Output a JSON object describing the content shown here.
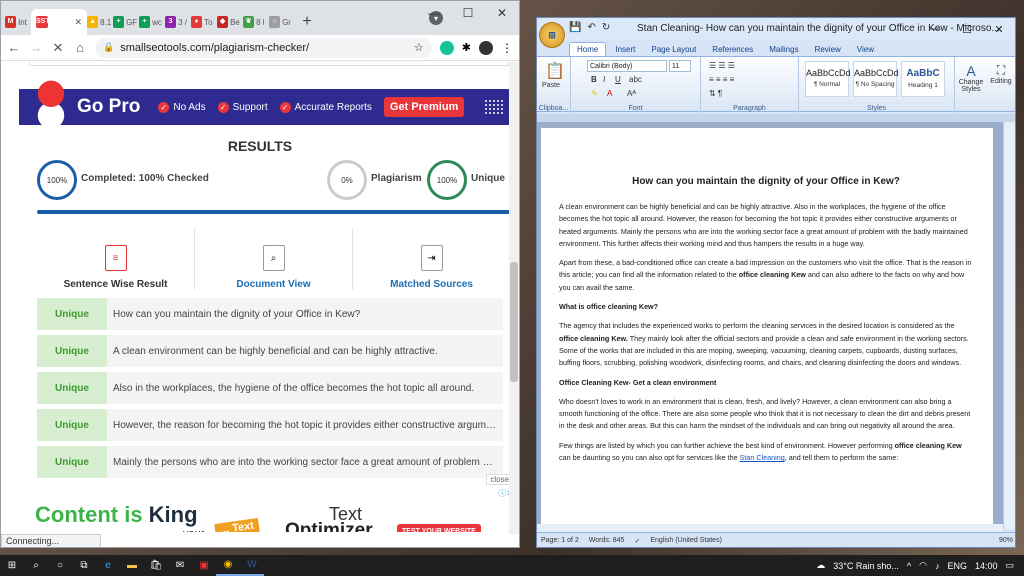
{
  "chrome": {
    "tabs": [
      {
        "label": "Int",
        "icon": "gmail-icon",
        "color": "#d93025",
        "glyph": "M"
      },
      {
        "label": "",
        "icon": "sst-icon",
        "color": "#e8363b",
        "glyph": "SST",
        "active": true
      },
      {
        "label": "8.1",
        "icon": "drive-icon",
        "color": "#f4b400",
        "glyph": "▲"
      },
      {
        "label": "GF",
        "icon": "sheets-icon",
        "color": "#0f9d58",
        "glyph": "+"
      },
      {
        "label": "wc",
        "icon": "sheets-icon",
        "color": "#0f9d58",
        "glyph": "+"
      },
      {
        "label": "3 /",
        "icon": "tab-icon",
        "color": "#8e24aa",
        "glyph": "3"
      },
      {
        "label": "To",
        "icon": "tab-icon",
        "color": "#e53935",
        "glyph": "♦"
      },
      {
        "label": "Be",
        "icon": "tab-icon",
        "color": "#c62828",
        "glyph": "◆"
      },
      {
        "label": "8 l",
        "icon": "leaf-icon",
        "color": "#43a047",
        "glyph": "❦"
      },
      {
        "label": "Gr",
        "icon": "tab-icon",
        "color": "#9e9e9e",
        "glyph": "○"
      }
    ],
    "new_tab": "+",
    "url": "smallseotools.com/plagiarism-checker/",
    "status": "Connecting..."
  },
  "promo": {
    "title": "Go Pro",
    "features": [
      "No Ads",
      "Support",
      "Accurate Reports"
    ],
    "cta": "Get Premium"
  },
  "results": {
    "heading": "RESULTS",
    "completed_pct": "100%",
    "completed_label": "Completed: 100% Checked",
    "plag_pct": "0%",
    "plag_label": "Plagiarism",
    "unique_pct": "100%",
    "unique_label": "Unique",
    "views": [
      "Sentence Wise Result",
      "Document View",
      "Matched Sources"
    ],
    "rows": [
      {
        "badge": "Unique",
        "text": "How can you maintain the dignity of your Office in Kew?"
      },
      {
        "badge": "Unique",
        "text": "A clean environment can be highly beneficial and can be highly attractive."
      },
      {
        "badge": "Unique",
        "text": "Also in the workplaces, the hygiene of the office becomes the hot topic all around."
      },
      {
        "badge": "Unique",
        "text": "However, the reason for becoming the hot topic it provides either constructive argument..."
      },
      {
        "badge": "Unique",
        "text": "Mainly the persons who are into the working sector face a great amount of problem wit..."
      }
    ]
  },
  "ad": {
    "close": "close",
    "line1a": "Content is ",
    "line1b": "King",
    "your": "your",
    "text_badge": "... Text",
    "t1": "Text",
    "t2": "Optimizer",
    "cta": "TEST YOUR WEBSITE"
  },
  "word": {
    "title": "Stan Cleaning- How can you maintain the dignity of your Office in Kew - Microso...",
    "tabs": [
      "Home",
      "Insert",
      "Page Layout",
      "References",
      "Mailings",
      "Review",
      "View"
    ],
    "font": "Calibri (Body)",
    "size": "11",
    "groups": [
      "Clipboa...",
      "Font",
      "Paragraph",
      "Styles"
    ],
    "paste": "Paste",
    "styles": [
      {
        "sample": "AaBbCcDd",
        "name": "¶ Normal"
      },
      {
        "sample": "AaBbCcDd",
        "name": "¶ No Spacing"
      },
      {
        "sample": "AaBbC",
        "name": "Heading 1"
      }
    ],
    "change_styles": "Change Styles",
    "editing": "Editing",
    "doc": {
      "heading": "How can you maintain the dignity of your Office in Kew?",
      "p1": "A clean environment can be highly beneficial and can be highly attractive. Also in the workplaces, the hygiene of the office becomes the hot topic all around. However, the reason for becoming the hot topic it provides either constructive arguments or heated arguments. Mainly the persons who are into the working sector face a great amount of problem with the badly maintained environment. This further affects their working mind and thus hampers the results in a huge way.",
      "p2a": "Apart from these, a bad-conditioned office can create a bad impression on the customers who visit the office. That is the reason in this article; you can find all the information related to the ",
      "p2b": "office cleaning Kew",
      "p2c": " and can also adhere to the facts on why and how you can avail the same.",
      "h2": "What is office cleaning Kew?",
      "p3a": "The agency that includes the experienced works to perform the cleaning services in the desired location is considered as the ",
      "p3b": "office cleaning Kew.",
      "p3c": " They mainly look after the official sectors and provide a clean and safe environment in the working sectors. Some of the works that are included in this are moping, sweeping, vacuuming, cleaning carpets, cupboards, dusting surfaces, buffing floors, scrubbing, polishing woodwork, disinfecting rooms, and chairs, and cleaning disinfecting the doors and windows.",
      "h3": "Office Cleaning Kew- Get a clean environment",
      "p4": "Who doesn't loves to work in an environment that is clean, fresh, and lively? However, a clean environment can also bring a smooth functioning of the office. There are also some people who think that it is not necessary to clean the dirt and debris present in the desk and other areas. But this can harm the mindset of the individuals and can bring out negativity all around the area.",
      "p5a": "Few things are listed by which you can further achieve the best kind of environment. However performing ",
      "p5b": "office cleaning Kew",
      "p5c": " can be daunting so you can also opt for services like the ",
      "p5link": "Stan Cleaning",
      "p5d": ", and tell them to perform the same:"
    },
    "status": {
      "page": "Page: 1 of 2",
      "words": "Words: 845",
      "lang": "English (United States)",
      "zoom": "90%"
    }
  },
  "taskbar": {
    "weather": "33°C  Rain sho...",
    "lang": "ENG",
    "time": "14:00"
  }
}
